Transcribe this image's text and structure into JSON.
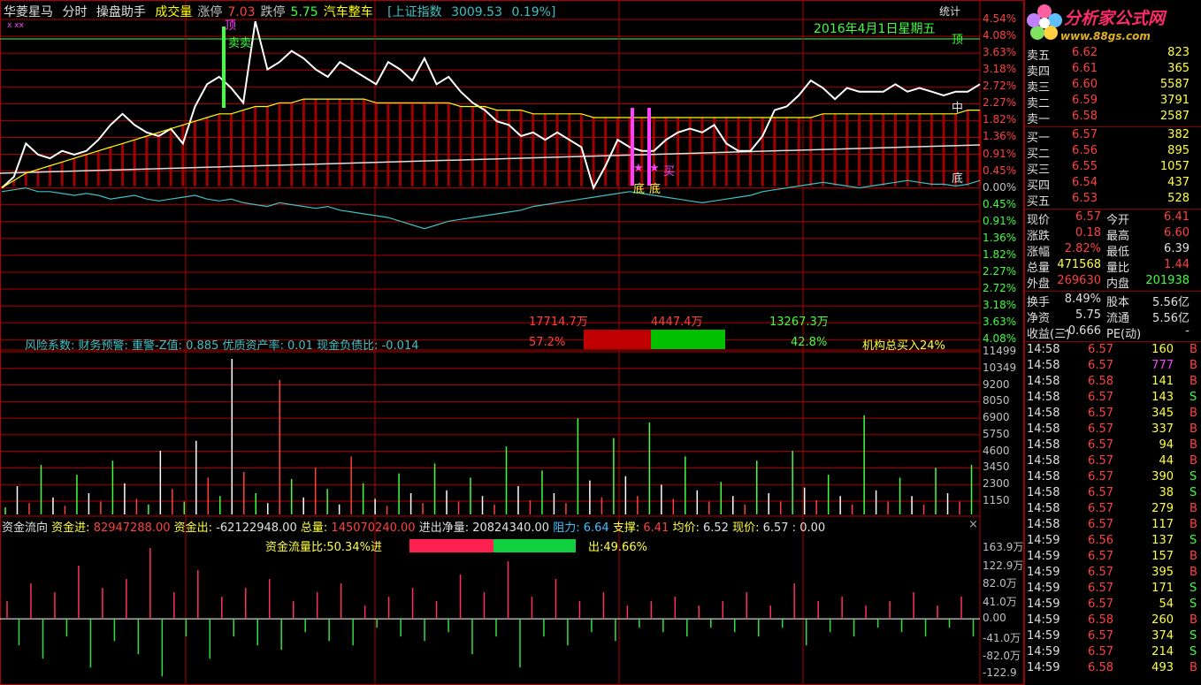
{
  "header": {
    "stock_name": "华菱星马",
    "mode": "分时",
    "indicator": "操盘助手",
    "items": [
      {
        "label": "成交量",
        "color": "#ffff00"
      },
      {
        "label": "涨停",
        "color": "#c0c0c0"
      },
      {
        "label": "7.03",
        "color": "#ff4040"
      },
      {
        "label": "跌停",
        "color": "#c0c0c0"
      },
      {
        "label": "5.75",
        "color": "#40ff40"
      },
      {
        "label": "汽车整车",
        "color": "#ffff00"
      }
    ],
    "index_text": "[上证指数",
    "index_value": "3009.53",
    "index_change": "0.19%]",
    "stats_button": "统计",
    "date_label": "2016年4月1日星期五",
    "marker": "x xx"
  },
  "price_chart": {
    "right_labels": [
      "4.54%",
      "4.08%",
      "3.63%",
      "3.18%",
      "2.72%",
      "2.27%",
      "1.82%",
      "1.36%",
      "0.91%",
      "0.45%",
      "0.00%",
      "0.45%",
      "0.91%",
      "1.36%",
      "1.82%",
      "2.27%",
      "2.72%",
      "3.18%",
      "3.63%",
      "4.08%"
    ],
    "right_label_colors": [
      "#ff4040",
      "#ff4040",
      "#ff4040",
      "#ff4040",
      "#ff4040",
      "#ff4040",
      "#ff4040",
      "#ff4040",
      "#ff4040",
      "#ff4040",
      "#c0c0c0",
      "#40ff40",
      "#40ff40",
      "#40ff40",
      "#40ff40",
      "#40ff40",
      "#40ff40",
      "#40ff40",
      "#40ff40",
      "#40ff40"
    ],
    "zone_labels": {
      "top": "顶",
      "mid": "中",
      "bottom": "底"
    },
    "annotations": {
      "top_mark": "顶",
      "sell_mark": "卖卖",
      "bottom_mark1": "底",
      "bottom_mark2": "底",
      "buy_mark": "买",
      "star": "★"
    },
    "risk_text": "风险系数: 财务预警: 重警-Z值: 0.885 优质资产率: 0.01 现金负债比: -0.014",
    "flow_values": {
      "left": "17714.7万",
      "mid": "4447.4万",
      "right": "13267.3万"
    },
    "flow_pcts": {
      "buy": "57.2%",
      "sell": "42.8%"
    },
    "flow_ratio": {
      "buy": 0.572,
      "sell": 0.428
    },
    "institution_text": "机构总买入24%"
  },
  "volume_chart": {
    "right_labels": [
      "11499",
      "10349",
      "9200",
      "8050",
      "6900",
      "5750",
      "4600",
      "3450",
      "2300",
      "1150"
    ]
  },
  "fund_flow": {
    "title": "资金流向",
    "in_label": "资金进:",
    "in_value": "82947288.00",
    "out_label": "资金出:",
    "out_value": "-62122948.00",
    "total_label": "总量:",
    "total_value": "145070240.00",
    "net_label": "进出净量:",
    "net_value": "20824340.00",
    "resist_label": "阻力:",
    "resist_value": "6.64",
    "support_label": "支撑:",
    "support_value": "6.41",
    "avg_label": "均价:",
    "avg_value": "6.52",
    "price_label": "现价:",
    "price_value": "6.57 : 0.00",
    "ratio_text": "资金流量比:50.34%进",
    "out_text": "出:49.66%",
    "ratio": {
      "in": 0.5034,
      "out": 0.4966
    },
    "right_labels": [
      "163.9万",
      "122.9万",
      "82.0万",
      "41.0万",
      "0.00",
      "-41.0万",
      "-82.0万",
      "-122.9"
    ]
  },
  "side_panel": {
    "logo_text": "分析家公式网",
    "logo_url": "www.88gs.com",
    "sells": [
      {
        "label": "卖五",
        "price": "6.62",
        "vol": "823"
      },
      {
        "label": "卖四",
        "price": "6.61",
        "vol": "365"
      },
      {
        "label": "卖三",
        "price": "6.60",
        "vol": "5587"
      },
      {
        "label": "卖二",
        "price": "6.59",
        "vol": "3791"
      },
      {
        "label": "卖一",
        "price": "6.58",
        "vol": "2587"
      }
    ],
    "buys": [
      {
        "label": "买一",
        "price": "6.57",
        "vol": "382"
      },
      {
        "label": "买二",
        "price": "6.56",
        "vol": "895"
      },
      {
        "label": "买三",
        "price": "6.55",
        "vol": "1057"
      },
      {
        "label": "买四",
        "price": "6.54",
        "vol": "437"
      },
      {
        "label": "买五",
        "price": "6.53",
        "vol": "528"
      }
    ],
    "quote": [
      {
        "l1": "现价",
        "v1": "6.57",
        "c1": "#ff4040",
        "l2": "今开",
        "v2": "6.41",
        "c2": "#ff4040"
      },
      {
        "l1": "涨跌",
        "v1": "0.18",
        "c1": "#ff4040",
        "l2": "最高",
        "v2": "6.60",
        "c2": "#ff4040"
      },
      {
        "l1": "涨幅",
        "v1": "2.82%",
        "c1": "#ff4040",
        "l2": "最低",
        "v2": "6.39",
        "c2": "#e0e0e0"
      },
      {
        "l1": "总量",
        "v1": "471568",
        "c1": "#ffff40",
        "l2": "量比",
        "v2": "1.44",
        "c2": "#ff4040"
      },
      {
        "l1": "外盘",
        "v1": "269630",
        "c1": "#ff4040",
        "l2": "内盘",
        "v2": "201938",
        "c2": "#40ff40"
      }
    ],
    "fund": [
      {
        "l1": "换手",
        "v1": "8.49%",
        "l2": "股本",
        "v2": "5.56亿"
      },
      {
        "l1": "净资",
        "v1": "5.75",
        "l2": "流通",
        "v2": "5.56亿"
      },
      {
        "l1": "收益(三)",
        "v1": "-0.666",
        "l2": "PE(动)",
        "v2": "-"
      }
    ],
    "ticks": [
      {
        "time": "14:58",
        "price": "6.57",
        "vol": "160",
        "side": "B",
        "pc": "#ff4040",
        "vc": "#ffff40"
      },
      {
        "time": "14:58",
        "price": "6.57",
        "vol": "777",
        "side": "B",
        "pc": "#ff4040",
        "vc": "#ff40ff"
      },
      {
        "time": "14:58",
        "price": "6.58",
        "vol": "141",
        "side": "B",
        "pc": "#ff4040",
        "vc": "#ffff40"
      },
      {
        "time": "14:58",
        "price": "6.57",
        "vol": "143",
        "side": "S",
        "pc": "#ff4040",
        "vc": "#ffff40"
      },
      {
        "time": "14:58",
        "price": "6.57",
        "vol": "345",
        "side": "B",
        "pc": "#ff4040",
        "vc": "#ffff40"
      },
      {
        "time": "14:58",
        "price": "6.57",
        "vol": "337",
        "side": "B",
        "pc": "#ff4040",
        "vc": "#ffff40"
      },
      {
        "time": "14:58",
        "price": "6.57",
        "vol": "94",
        "side": "B",
        "pc": "#ff4040",
        "vc": "#ffff40"
      },
      {
        "time": "14:58",
        "price": "6.57",
        "vol": "44",
        "side": "B",
        "pc": "#ff4040",
        "vc": "#ffff40"
      },
      {
        "time": "14:58",
        "price": "6.57",
        "vol": "390",
        "side": "S",
        "pc": "#ff4040",
        "vc": "#ffff40"
      },
      {
        "time": "14:58",
        "price": "6.57",
        "vol": "38",
        "side": "S",
        "pc": "#ff4040",
        "vc": "#ffff40"
      },
      {
        "time": "14:58",
        "price": "6.57",
        "vol": "279",
        "side": "B",
        "pc": "#ff4040",
        "vc": "#ffff40"
      },
      {
        "time": "14:58",
        "price": "6.57",
        "vol": "117",
        "side": "B",
        "pc": "#ff4040",
        "vc": "#ffff40"
      },
      {
        "time": "14:59",
        "price": "6.56",
        "vol": "137",
        "side": "S",
        "pc": "#ff4040",
        "vc": "#ffff40"
      },
      {
        "time": "14:59",
        "price": "6.57",
        "vol": "157",
        "side": "B",
        "pc": "#ff4040",
        "vc": "#ffff40"
      },
      {
        "time": "14:59",
        "price": "6.57",
        "vol": "395",
        "side": "B",
        "pc": "#ff4040",
        "vc": "#ffff40"
      },
      {
        "time": "14:59",
        "price": "6.57",
        "vol": "171",
        "side": "S",
        "pc": "#ff4040",
        "vc": "#ffff40"
      },
      {
        "time": "14:59",
        "price": "6.57",
        "vol": "54",
        "side": "S",
        "pc": "#ff4040",
        "vc": "#ffff40"
      },
      {
        "time": "14:59",
        "price": "6.58",
        "vol": "260",
        "side": "B",
        "pc": "#ff4040",
        "vc": "#ffff40"
      },
      {
        "time": "14:59",
        "price": "6.57",
        "vol": "374",
        "side": "S",
        "pc": "#ff4040",
        "vc": "#ffff40"
      },
      {
        "time": "14:59",
        "price": "6.57",
        "vol": "214",
        "side": "S",
        "pc": "#ff4040",
        "vc": "#ffff40"
      },
      {
        "time": "14:59",
        "price": "6.58",
        "vol": "493",
        "side": "B",
        "pc": "#ff4040",
        "vc": "#ffff40"
      }
    ]
  },
  "colors": {
    "grid": "#b00000",
    "up": "#ff3030",
    "down": "#30ff30",
    "price_line": "#ffffff",
    "avg_line": "#ffff00",
    "index_line": "#40c0c0"
  },
  "chart_data": [
    {
      "type": "line",
      "title": "分时",
      "series": [
        {
          "name": "price",
          "color": "#ffffff",
          "values": [
            0.0,
            0.3,
            1.2,
            0.9,
            0.8,
            1.0,
            0.9,
            1.0,
            1.3,
            1.7,
            2.0,
            1.7,
            1.5,
            1.4,
            1.6,
            1.2,
            2.2,
            2.8,
            3.0,
            2.7,
            2.3,
            4.5,
            3.2,
            3.4,
            3.7,
            3.5,
            3.2,
            3.0,
            3.4,
            3.2,
            3.0,
            2.8,
            3.4,
            3.2,
            2.9,
            3.5,
            2.8,
            3.0,
            2.6,
            2.3,
            2.1,
            1.8,
            1.7,
            1.4,
            1.5,
            1.3,
            1.5,
            1.3,
            1.1,
            0.0,
            0.6,
            1.3,
            1.1,
            1.0,
            1.0,
            1.3,
            1.5,
            1.6,
            1.5,
            1.7,
            1.2,
            1.0,
            1.0,
            1.4,
            2.1,
            2.2,
            2.5,
            2.9,
            2.7,
            2.4,
            2.7,
            2.6,
            2.6,
            2.6,
            2.8,
            2.6,
            2.7,
            2.6,
            2.5,
            2.6,
            2.6,
            2.8
          ]
        },
        {
          "name": "average",
          "color": "#ffff00",
          "values": [
            0.0,
            0.2,
            0.4,
            0.5,
            0.6,
            0.7,
            0.8,
            0.9,
            1.0,
            1.1,
            1.2,
            1.3,
            1.4,
            1.5,
            1.6,
            1.7,
            1.8,
            1.9,
            2.0,
            2.0,
            2.1,
            2.2,
            2.2,
            2.3,
            2.3,
            2.4,
            2.4,
            2.4,
            2.4,
            2.4,
            2.4,
            2.3,
            2.3,
            2.3,
            2.3,
            2.3,
            2.3,
            2.3,
            2.2,
            2.2,
            2.2,
            2.1,
            2.1,
            2.1,
            2.0,
            2.0,
            2.0,
            2.0,
            2.0,
            1.9,
            1.9,
            1.9,
            1.9,
            1.9,
            1.9,
            1.9,
            1.9,
            1.9,
            1.9,
            1.9,
            1.9,
            1.9,
            1.9,
            1.9,
            1.9,
            1.9,
            1.9,
            1.9,
            2.0,
            2.0,
            2.0,
            2.0,
            2.0,
            2.0,
            2.0,
            2.0,
            2.0,
            2.0,
            2.0,
            2.0,
            2.1,
            2.1
          ]
        },
        {
          "name": "index",
          "color": "#40c0c0",
          "values": [
            -0.1,
            -0.05,
            0.0,
            -0.1,
            -0.1,
            -0.15,
            -0.2,
            -0.15,
            -0.2,
            -0.3,
            -0.25,
            -0.2,
            -0.3,
            -0.35,
            -0.3,
            -0.25,
            -0.2,
            -0.3,
            -0.35,
            -0.3,
            -0.4,
            -0.45,
            -0.5,
            -0.4,
            -0.45,
            -0.5,
            -0.55,
            -0.5,
            -0.6,
            -0.65,
            -0.7,
            -0.75,
            -0.8,
            -0.9,
            -1.0,
            -1.1,
            -1.0,
            -0.9,
            -0.85,
            -0.8,
            -0.75,
            -0.7,
            -0.65,
            -0.6,
            -0.5,
            -0.45,
            -0.4,
            -0.35,
            -0.3,
            -0.25,
            -0.2,
            -0.15,
            -0.1,
            -0.15,
            -0.2,
            -0.25,
            -0.3,
            -0.35,
            -0.4,
            -0.35,
            -0.3,
            -0.25,
            -0.2,
            -0.1,
            -0.05,
            0.0,
            0.05,
            0.1,
            0.15,
            0.1,
            0.05,
            0.0,
            0.05,
            0.1,
            0.15,
            0.2,
            0.15,
            0.1,
            0.1,
            0.05,
            0.1,
            0.2
          ]
        }
      ],
      "ylim": [
        -4.08,
        4.54
      ]
    },
    {
      "type": "bar",
      "title": "成交量",
      "ylim": [
        0,
        11499
      ],
      "values": [
        500,
        2000,
        800,
        3500,
        1200,
        600,
        2800,
        1500,
        900,
        3800,
        2200,
        1100,
        700,
        4500,
        1800,
        900,
        5200,
        2600,
        1300,
        11000,
        3000,
        1500,
        800,
        9500,
        2500,
        1200,
        3300,
        1800,
        700,
        4100,
        2200,
        1100,
        600,
        2900,
        1500,
        800,
        3600,
        1700,
        900,
        2600,
        1300,
        700,
        4800,
        2000,
        1000,
        3100,
        1500,
        800,
        6800,
        2400,
        1200,
        5400,
        2700,
        1300,
        6500,
        2100,
        1100,
        4100,
        1700,
        900,
        2300,
        1300,
        700,
        3800,
        1500,
        900,
        4500,
        1900,
        1000,
        2800,
        1300,
        700,
        7000,
        1700,
        900,
        2600,
        1300,
        700,
        3300,
        1500,
        900,
        3500
      ]
    },
    {
      "type": "bar",
      "title": "资金流向",
      "ylim": [
        -122.9,
        163.9
      ],
      "values": [
        40,
        -60,
        80,
        -90,
        60,
        -40,
        120,
        -110,
        70,
        -50,
        90,
        -80,
        160,
        -130,
        60,
        -40,
        110,
        -90,
        50,
        -40,
        70,
        -60,
        90,
        -70,
        40,
        -30,
        60,
        -50,
        80,
        -60,
        30,
        -20,
        50,
        -40,
        70,
        -50,
        40,
        -30,
        100,
        -80,
        60,
        -40,
        130,
        -110,
        50,
        -40,
        90,
        -60,
        40,
        -30,
        60,
        -50,
        30,
        -20,
        40,
        -30,
        50,
        -40,
        30,
        -20,
        40,
        -30,
        60,
        -40,
        30,
        -20,
        80,
        -60,
        40,
        -30,
        50,
        -40,
        30,
        -20,
        40,
        -30,
        60,
        -40,
        30,
        -20,
        50,
        -40
      ]
    }
  ]
}
